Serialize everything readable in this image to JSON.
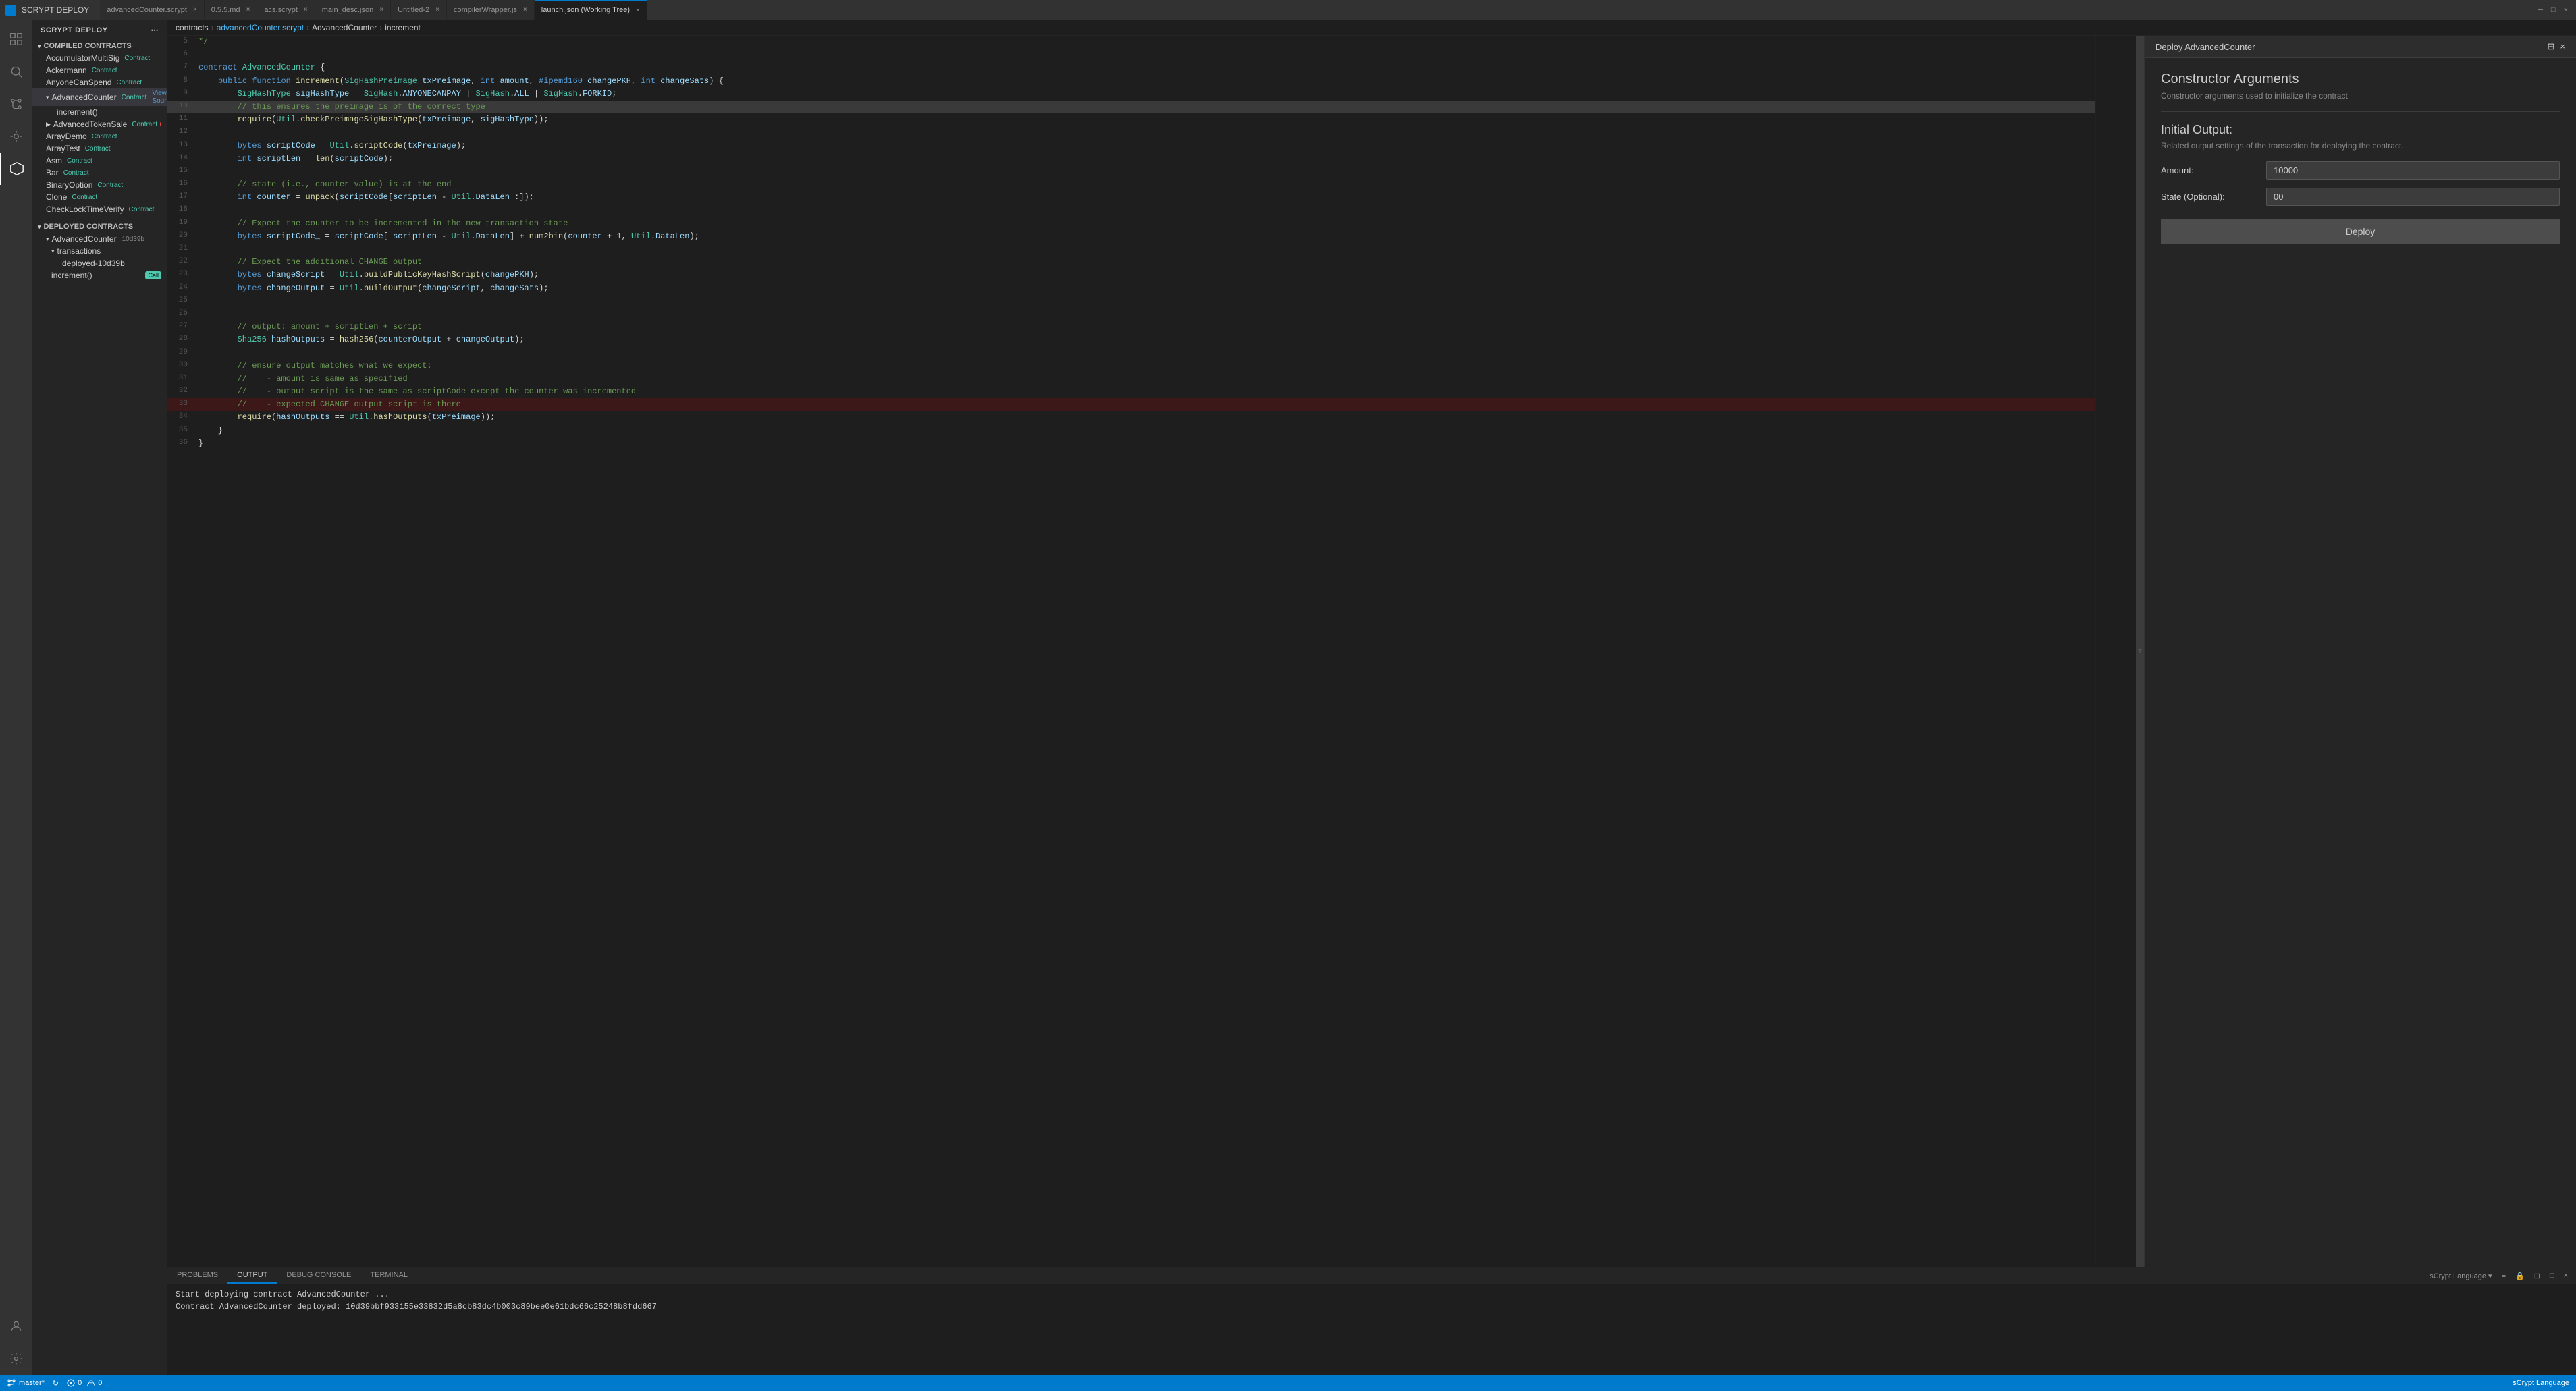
{
  "titlebar": {
    "icon_text": "S",
    "app_name": "SCRYPT DEPLOY",
    "tabs": [
      {
        "label": "advancedCounter.scrypt",
        "active": false,
        "modified": false,
        "icon": "file"
      },
      {
        "label": "0.5.5.md",
        "active": false,
        "modified": false,
        "icon": "file"
      },
      {
        "label": "acs.scrypt",
        "active": false,
        "modified": false,
        "icon": "file"
      },
      {
        "label": "main_desc.json",
        "active": false,
        "modified": false,
        "icon": "file"
      },
      {
        "label": "Untitled-2",
        "active": false,
        "modified": false,
        "icon": "file"
      },
      {
        "label": "compilerWrapper.js",
        "active": false,
        "modified": false,
        "icon": "file"
      },
      {
        "label": "launch.json (Working Tree)",
        "active": true,
        "modified": false,
        "icon": "file"
      }
    ]
  },
  "sidebar": {
    "title": "SCRYPT DEPLOY",
    "more_icon": "⋯",
    "compiled_section": "COMPILED CONTRACTS",
    "compiled_items": [
      {
        "label": "AccumulatorMultiSig",
        "tag": "Contract"
      },
      {
        "label": "Ackermann",
        "tag": "Contract"
      },
      {
        "label": "AnyoneCanSpend",
        "tag": "Contract"
      },
      {
        "label": "AdvancedCounter",
        "tag": "Contract",
        "active": true,
        "expanded": true,
        "view_source": true
      },
      {
        "label": "increment()",
        "indent": 3
      },
      {
        "label": "AdvancedTokenSale",
        "tag": "Contract",
        "dot_red": true
      },
      {
        "label": "ArrayDemo",
        "tag": "Contract"
      },
      {
        "label": "ArrayTest",
        "tag": "Contract"
      },
      {
        "label": "Asm",
        "tag": "Contract"
      },
      {
        "label": "Bar",
        "tag": "Contract"
      },
      {
        "label": "BinaryOption",
        "tag": "Contract"
      },
      {
        "label": "Clone",
        "tag": "Contract"
      },
      {
        "label": "CheckLockTimeVerify",
        "tag": "Contract"
      }
    ],
    "deployed_section": "DEPLOYED CONTRACTS",
    "deployed_items": [
      {
        "label": "AdvancedCounter",
        "address": "10d39b",
        "expanded": true
      },
      {
        "label": "transactions",
        "indent": 2,
        "expanded": true
      },
      {
        "label": "deployed-10d39b",
        "indent": 4
      },
      {
        "label": "increment()",
        "indent": 3,
        "call_badge": "Call"
      }
    ]
  },
  "breadcrumb": {
    "items": [
      "contracts",
      "advancedCounter.scrypt",
      "AdvancedCounter",
      "increment"
    ]
  },
  "editor": {
    "lines": [
      {
        "num": 5,
        "content": "*/"
      },
      {
        "num": 6,
        "content": ""
      },
      {
        "num": 7,
        "content": "contract AdvancedCounter {"
      },
      {
        "num": 8,
        "content": "    public function increment(SigHashPreimage txPreimage, int amount, #ipemd160 changePKH, int changeSats) {"
      },
      {
        "num": 9,
        "content": "        SigHashType sigHashType = SigHash.ANYONECANPAY | SigHash.ALL | SigHash.FORKID;"
      },
      {
        "num": 10,
        "content": "        // this ensures the preimage is of the correct type",
        "highlighted": true
      },
      {
        "num": 11,
        "content": "        require(Util.checkPreimageSigHashType(txPreimage, sigHashType));"
      },
      {
        "num": 12,
        "content": ""
      },
      {
        "num": 13,
        "content": "        bytes scriptCode = Util.scriptCode(txPreimage);"
      },
      {
        "num": 14,
        "content": "        int scriptLen = len(scriptCode);"
      },
      {
        "num": 15,
        "content": ""
      },
      {
        "num": 16,
        "content": "        // state (i.e., counter value) is at the end"
      },
      {
        "num": 17,
        "content": "        int counter = unpack(scriptCode[scriptLen - Util.DataLen :]);"
      },
      {
        "num": 18,
        "content": ""
      },
      {
        "num": 19,
        "content": "        // Expect the counter to be incremented in the new transaction state"
      },
      {
        "num": 20,
        "content": "        bytes scriptCode_ = scriptCode[ scriptLen - Util.DataLen] + num2bin(counter + 1, Util.DataLen);"
      },
      {
        "num": 21,
        "content": ""
      },
      {
        "num": 22,
        "content": "        // Expect the additional CHANGE output"
      },
      {
        "num": 23,
        "content": "        bytes changeScript = Util.buildPublicKeyHashScript(changePKH);"
      },
      {
        "num": 24,
        "content": "        bytes changeOutput = Util.buildOutput(changeScript, changeSats);"
      },
      {
        "num": 25,
        "content": ""
      },
      {
        "num": 26,
        "content": ""
      },
      {
        "num": 27,
        "content": "        // output: amount + scriptLen + script"
      },
      {
        "num": 28,
        "content": "        Sha256 hashOutputs = hash256(counterOutput + changeOutput);"
      },
      {
        "num": 29,
        "content": ""
      },
      {
        "num": 30,
        "content": "        // ensure output matches what we expect:"
      },
      {
        "num": 31,
        "content": "        //    - amount is same as specified"
      },
      {
        "num": 32,
        "content": "        //    - output script is the same as scriptCode except the counter was incremented"
      },
      {
        "num": 33,
        "content": "        //    - expected CHANGE output script is there",
        "error": true
      },
      {
        "num": 34,
        "content": "        require(hashOutputs == Util.hashOutputs(txPreimage));"
      },
      {
        "num": 35,
        "content": "    }"
      },
      {
        "num": 36,
        "content": "}"
      }
    ]
  },
  "deploy_panel": {
    "title": "Deploy AdvancedCounter",
    "close_label": "×",
    "constructor_args_title": "Constructor Arguments",
    "constructor_args_subtitle": "Constructor arguments used to initialize the contract",
    "initial_output_title": "Initial Output:",
    "initial_output_subtitle": "Related output settings of the transaction for deploying the contract.",
    "amount_label": "Amount:",
    "amount_value": "10000",
    "state_label": "State (Optional):",
    "state_value": "00",
    "deploy_button_label": "Deploy"
  },
  "bottom_panel": {
    "tabs": [
      {
        "label": "PROBLEMS",
        "active": false
      },
      {
        "label": "OUTPUT",
        "active": true
      },
      {
        "label": "DEBUG CONSOLE",
        "active": false
      },
      {
        "label": "TERMINAL",
        "active": false
      }
    ],
    "tab_actions": [
      "sCrypt Language",
      "≡",
      "🔒",
      "⊟",
      "□",
      "×"
    ],
    "output_lines": [
      "Start deploying contract AdvancedCounter ...",
      "Contract AdvancedCounter deployed: 10d39bbf933155e33832d5a8cb83dc4b003c89bee0e61bdc66c25248b8fdd667"
    ]
  },
  "status_bar": {
    "branch": "master*",
    "sync_icon": "↻",
    "warning_count": "0",
    "error_count": "0",
    "right_items": [
      "scrypt Language"
    ]
  }
}
